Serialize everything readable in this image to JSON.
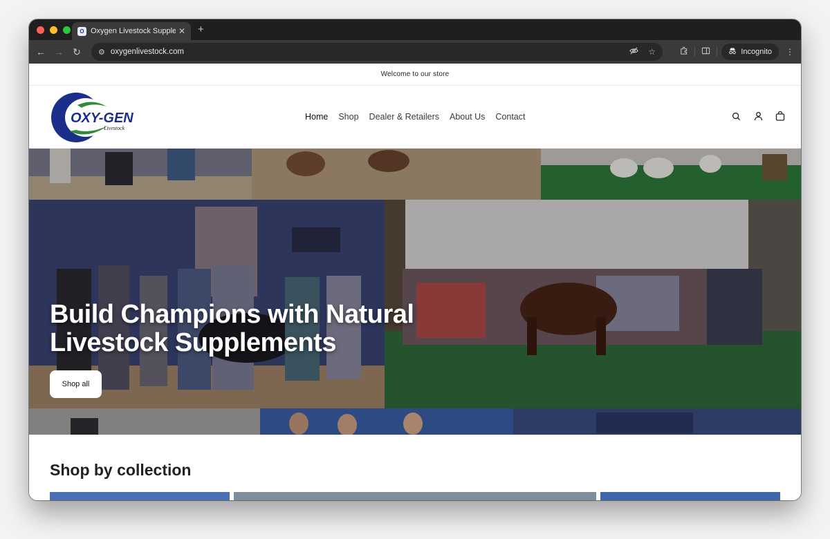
{
  "browser": {
    "tab_title": "Oxygen Livestock Supplemen",
    "url": "oxygenlivestock.com",
    "incognito_label": "Incognito"
  },
  "store": {
    "announcement": "Welcome to our store",
    "logo_text": "OXY-GEN",
    "logo_subtext": "Livestock",
    "nav": [
      "Home",
      "Shop",
      "Dealer & Retailers",
      "About Us",
      "Contact"
    ]
  },
  "hero": {
    "heading": "Build Champions with Natural Livestock Supplements",
    "button": "Shop all"
  },
  "collection": {
    "heading": "Shop by collection"
  },
  "colors": {
    "logo_blue": "#1b2f8a",
    "logo_green": "#2f8a3a"
  }
}
